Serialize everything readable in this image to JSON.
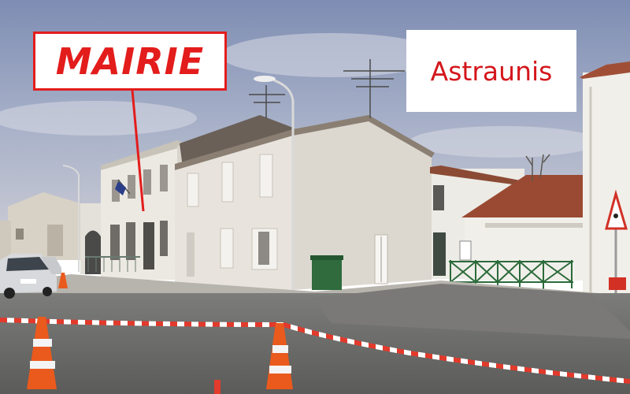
{
  "labels": {
    "mairie": "MAIRIE",
    "town_name": "Astraunis"
  },
  "colors": {
    "label_red": "#e31c1c",
    "town_red": "#d4161c",
    "sky": "#7f8fb4",
    "wall": "#e9e6e0",
    "roof": "#9a4a32",
    "road": "#6d6d6b"
  }
}
